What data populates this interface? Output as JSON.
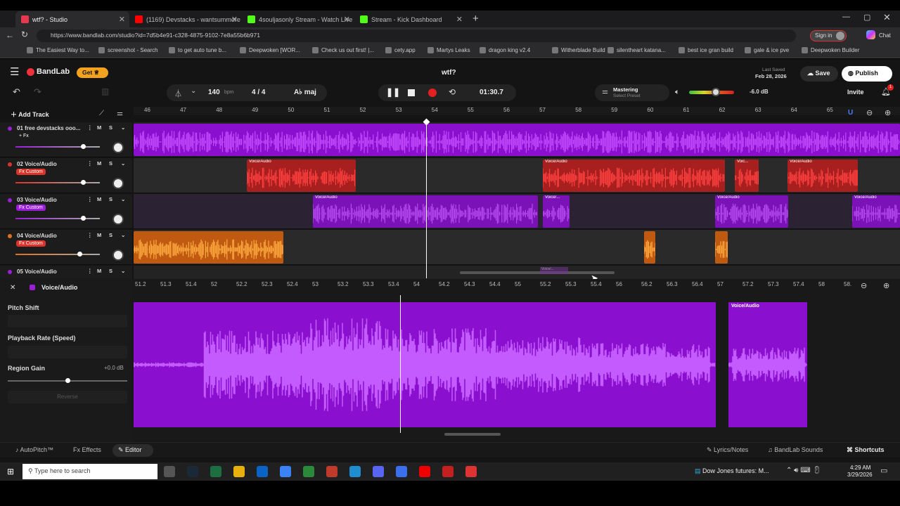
{
  "browser": {
    "tabs": [
      {
        "label": "wtf? - Studio",
        "fav": "bandlab-icon",
        "color": "#e8384f",
        "active": true
      },
      {
        "label": "(1169) Devstacks - wantsummore",
        "fav": "youtube-icon",
        "color": "#ff0000",
        "active": false
      },
      {
        "label": "4souljasonly Stream - Watch Live",
        "fav": "kick-icon",
        "color": "#53fc18",
        "active": false
      },
      {
        "label": "Stream - Kick Dashboard",
        "fav": "kick-icon",
        "color": "#53fc18",
        "active": false
      }
    ],
    "new_tab": "+",
    "url": "https://www.bandlab.com/studio?id=7d5b4e91-c328-4875-9102-7e8a55b6b971",
    "sign_in": "Sign in",
    "chat": "Chat",
    "bookmarks": [
      "The Easiest Way to...",
      "screenshot - Search",
      "to get auto tune b...",
      "Deepwoken [WOR...",
      "Check us out first! |...",
      "cety.app",
      "Martys Leaks",
      "dragon king v2.4",
      "Witherblade Build",
      "silentheart katana...",
      "best ice gran build",
      "gale & ice pve",
      "Deepwoken Builder"
    ]
  },
  "app": {
    "logo": "BandLab",
    "get_label": "Get",
    "project_title": "wtf?",
    "last_saved_label": "Last Saved",
    "last_saved_date": "Feb 28, 2026",
    "save_label": "Save",
    "publish_label": "Publish",
    "invite_label": "Invite",
    "notif_count": "1",
    "tempo": "140",
    "tempo_unit": "bpm",
    "time_signature": "4 / 4",
    "key": "A♭ maj",
    "time_display": "01:30.7",
    "mastering_label": "Mastering",
    "mastering_sub": "Select Preset",
    "volume_db": "-6.0 dB",
    "volume_level": 0.6,
    "add_track_label": "Add Track"
  },
  "ruler": [
    "46",
    "47",
    "48",
    "49",
    "50",
    "51",
    "52",
    "53",
    "54",
    "55",
    "56",
    "57",
    "58",
    "59",
    "60",
    "61",
    "62",
    "63",
    "64",
    "65"
  ],
  "tracks": [
    {
      "num": "01",
      "name": "free devstacks ooo...",
      "fx": "+ Fx",
      "fx_color": "none",
      "color": "#9b1fd6",
      "volume": 0.8
    },
    {
      "num": "02",
      "name": "Voice/Audio",
      "fx": "Fx Custom",
      "fx_color": "#d9342b",
      "color": "#d9342b",
      "volume": 0.8
    },
    {
      "num": "03",
      "name": "Voice/Audio",
      "fx": "Fx Custom",
      "fx_color": "#9b1fd6",
      "color": "#9b1fd6",
      "volume": 0.8
    },
    {
      "num": "04",
      "name": "Voice/Audio",
      "fx": "Fx Custom",
      "fx_color": "#d9342b",
      "color": "#e07020",
      "volume": 0.76
    },
    {
      "num": "05",
      "name": "Voice/Audio",
      "fx": "",
      "fx_color": "none",
      "color": "#9b1fd6",
      "volume": 0.8
    }
  ],
  "region_label": "Voice/Audio",
  "region_label_short": "Voice/...",
  "region_label_vo": "Voic...",
  "mute": "M",
  "solo": "S",
  "editor": {
    "title": "Voice/Audio",
    "pitch_shift": "Pitch Shift",
    "playback_rate": "Playback Rate (Speed)",
    "region_gain": "Region Gain",
    "region_gain_value": "+0.0 dB",
    "region_gain_level": 0.5,
    "reverse": "Reverse",
    "ruler": [
      "51.2",
      "51.3",
      "51.4",
      "52",
      "52.2",
      "52.3",
      "52.4",
      "53",
      "53.2",
      "53.3",
      "53.4",
      "54",
      "54.2",
      "54.3",
      "54.4",
      "55",
      "55.2",
      "55.3",
      "55.4",
      "56",
      "56.2",
      "56.3",
      "56.4",
      "57",
      "57.2",
      "57.3",
      "57.4",
      "58",
      "58."
    ],
    "region_label": "Voice/Audio"
  },
  "bottom": {
    "autopitch": "AutoPitch™",
    "effects": "Effects",
    "editor": "Editor",
    "lyrics": "Lyrics/Notes",
    "sounds": "BandLab Sounds",
    "shortcuts": "Shortcuts"
  },
  "taskbar": {
    "search_placeholder": "Type here to search",
    "news": "Dow Jones futures: M...",
    "time": "4:29 AM",
    "date": "3/29/2026"
  }
}
